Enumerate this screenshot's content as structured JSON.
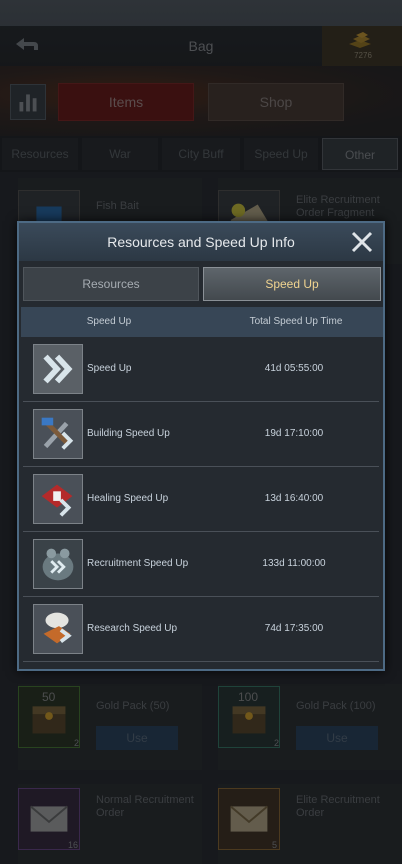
{
  "header": {
    "title": "Bag",
    "gold_count": "7276"
  },
  "main_tabs": [
    {
      "label": "Items",
      "active": true
    },
    {
      "label": "Shop",
      "active": false
    }
  ],
  "categories": [
    {
      "label": "Resources",
      "active": false
    },
    {
      "label": "War",
      "active": false
    },
    {
      "label": "City Buff",
      "active": false
    },
    {
      "label": "Speed Up",
      "active": false
    },
    {
      "label": "Other",
      "active": true
    }
  ],
  "bag_items": [
    {
      "name": "Fish Bait"
    },
    {
      "name": "Elite Recruitment Order Fragment"
    },
    {
      "name": "Gold Pack (50)",
      "badge": "50",
      "count": "2",
      "button": "Use"
    },
    {
      "name": "Gold Pack (100)",
      "badge": "100",
      "count": "2",
      "button": "Use"
    },
    {
      "name": "Normal Recruitment Order",
      "count": "16"
    },
    {
      "name": "Elite Recruitment Order",
      "count": "5"
    }
  ],
  "modal": {
    "title": "Resources and Speed Up Info",
    "tabs": [
      {
        "label": "Resources",
        "active": false
      },
      {
        "label": "Speed Up",
        "active": true
      }
    ],
    "columns": {
      "name": "Speed Up",
      "time": "Total Speed Up Time"
    },
    "rows": [
      {
        "name": "Speed Up",
        "time": "41d 05:55:00",
        "icon": "double-chevron-icon"
      },
      {
        "name": "Building Speed Up",
        "time": "19d 17:10:00",
        "icon": "hammer-wrench-icon"
      },
      {
        "name": "Healing Speed Up",
        "time": "13d 16:40:00",
        "icon": "medkit-icon"
      },
      {
        "name": "Recruitment Speed Up",
        "time": "133d 11:00:00",
        "icon": "helmet-icon"
      },
      {
        "name": "Research Speed Up",
        "time": "74d 17:35:00",
        "icon": "flask-icon"
      }
    ]
  },
  "colors": {
    "accent_gold": "#f0d490",
    "modal_border": "#4d6a84",
    "items_tab": "#6a1e1e"
  }
}
